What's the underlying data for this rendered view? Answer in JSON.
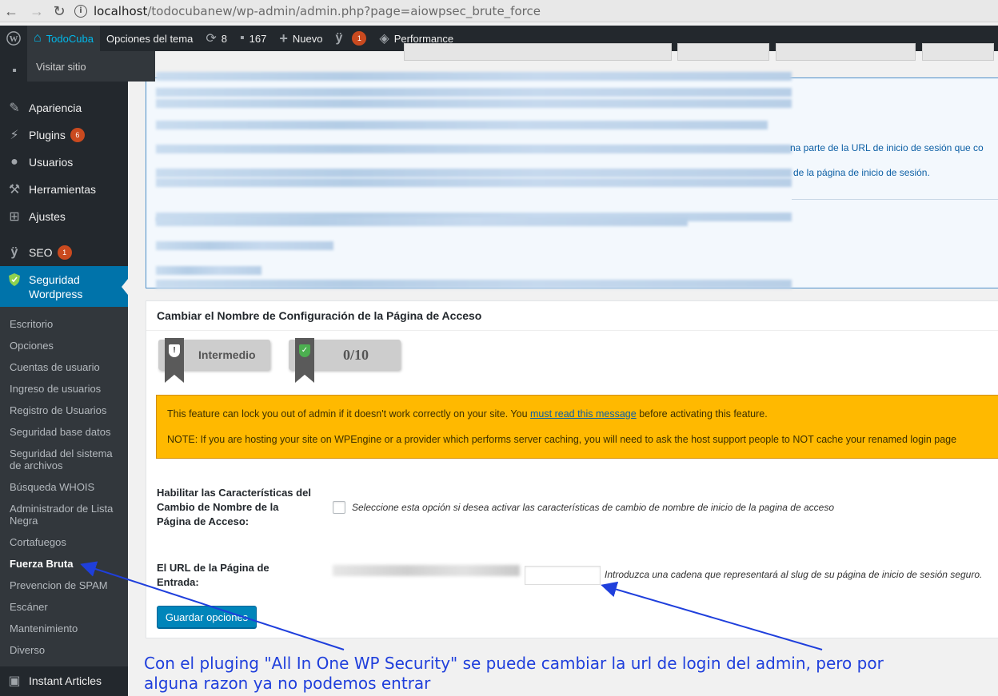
{
  "browser": {
    "url_host": "localhost",
    "url_path": "/todocubanew/wp-admin/admin.php?page=aiowpsec_brute_force"
  },
  "adminbar": {
    "site_name": "TodoCuba",
    "theme_options": "Opciones del tema",
    "updates_count": "8",
    "comments_count": "167",
    "new_label": "Nuevo",
    "yoast_badge": "1",
    "performance": "Performance",
    "visit_site": "Visitar sitio"
  },
  "sidebar": {
    "menu": [
      {
        "label": "Apariencia",
        "icon": "paintbrush-icon"
      },
      {
        "label": "Plugins",
        "icon": "plugin-icon",
        "badge": "6"
      },
      {
        "label": "Usuarios",
        "icon": "users-icon"
      },
      {
        "label": "Herramientas",
        "icon": "wrench-icon"
      },
      {
        "label": "Ajustes",
        "icon": "settings-icon"
      },
      {
        "label": "SEO",
        "icon": "yoast-icon",
        "badge": "1"
      },
      {
        "label": "Seguridad Wordpress",
        "icon": "shield-icon"
      }
    ],
    "submenu": [
      "Escritorio",
      "Opciones",
      "Cuentas de usuario",
      "Ingreso de usuarios",
      "Registro de Usuarios",
      "Seguridad base datos",
      "Seguridad del sistema de archivos",
      "Búsqueda WHOIS",
      "Administrador de Lista Negra",
      "Cortafuegos",
      "Fuerza Bruta",
      "Prevencion de SPAM",
      "Escáner",
      "Mantenimiento",
      "Diverso"
    ],
    "bottom_item": "Instant Articles"
  },
  "info_box": {
    "line1_tail": "na parte de la URL de inicio de sesión que co",
    "line2_tail": "de la página de inicio de sesión."
  },
  "panel": {
    "title": "Cambiar el Nombre de Configuración de la Página de Acceso",
    "level_label": "Intermedio",
    "score": "0/10",
    "warning_pre": "This feature can lock you out of admin if it doesn't work correctly on your site. You ",
    "warning_link": "must read this message",
    "warning_post": " before activating this feature.",
    "warning_note": "NOTE: If you are hosting your site on WPEngine or a provider which performs server caching, you will need to ask the host support people to NOT cache your renamed login page",
    "enable_label": "Habilitar las Características del Cambio de Nombre de la Página de Acceso:",
    "enable_desc": "Seleccione esta opción si desea activar las características de cambio de nombre de inicio de la pagina de acceso",
    "url_label": "El URL de la Página de Entrada:",
    "url_desc": "Introduzca una cadena que representará al slug de su página de inicio de sesión seguro.",
    "save_button": "Guardar opciones"
  },
  "annotation": {
    "line1": "Con el pluging \"All In One WP Security\" se puede cambiar la url de login del admin, pero por",
    "line2": "alguna razon  ya no podemos entrar"
  },
  "colors": {
    "admin_dark": "#23282d",
    "wp_blue": "#0073aa",
    "warning": "#ffb900",
    "annotation": "#1f3fdc"
  }
}
